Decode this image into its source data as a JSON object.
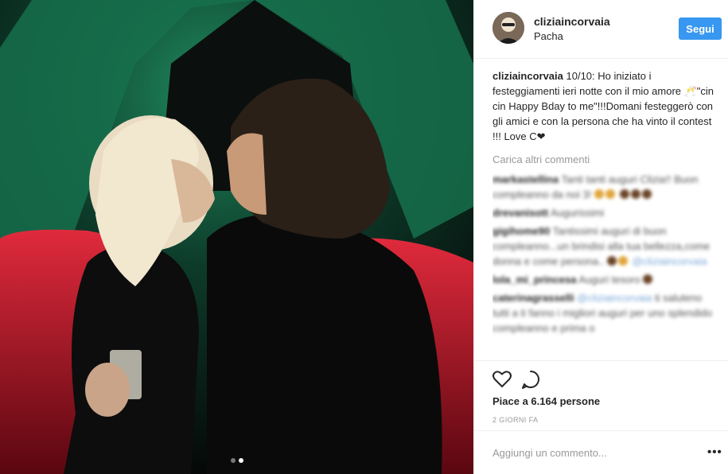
{
  "post": {
    "username": "cliziaincorvaia",
    "location": "Pacha",
    "follow_label": "Segui",
    "caption_user": "cliziaincorvaia",
    "caption_text": " 10/10: Ho iniziato i festeggiamenti ieri notte con il mio amore 🥂\"cin cin Happy Bday to me\"!!!Domani festeggerò con gli amici e con la persona che ha vinto il contest !!! Love C❤",
    "load_more": "Carica altri commenti",
    "likes": "Piace a 6.164 persone",
    "time": "2 GIORNI FA",
    "add_comment_placeholder": "Aggiungi un commento...",
    "more_label": "•••",
    "carousel_index": 1,
    "carousel_total": 2
  },
  "comments": [
    {
      "user": "markastellina",
      "text": "Tanti tanti auguri Clizia!! Buon compleanno da noi 3!"
    },
    {
      "user": "drevanisott",
      "text": "Augurissimi"
    },
    {
      "user": "gigihome90",
      "text": "Tantissimi auguri di buon compleanno...un brindisi alla tua bellezza,come donna e come persona..",
      "mention": "@cliziaincorvaia"
    },
    {
      "user": "lola_mi_princesa",
      "text": "Auguri tesoro"
    },
    {
      "user": "caterinagrasselli",
      "mention": "@cliziaincorvaia",
      "text": "ti saluteno tutti a ti fanno i migliori auguri per uno splendido compleanno e prima o"
    }
  ],
  "colors": {
    "accent": "#3897f0",
    "text": "#262626",
    "muted": "#999999",
    "border": "#efefef"
  }
}
